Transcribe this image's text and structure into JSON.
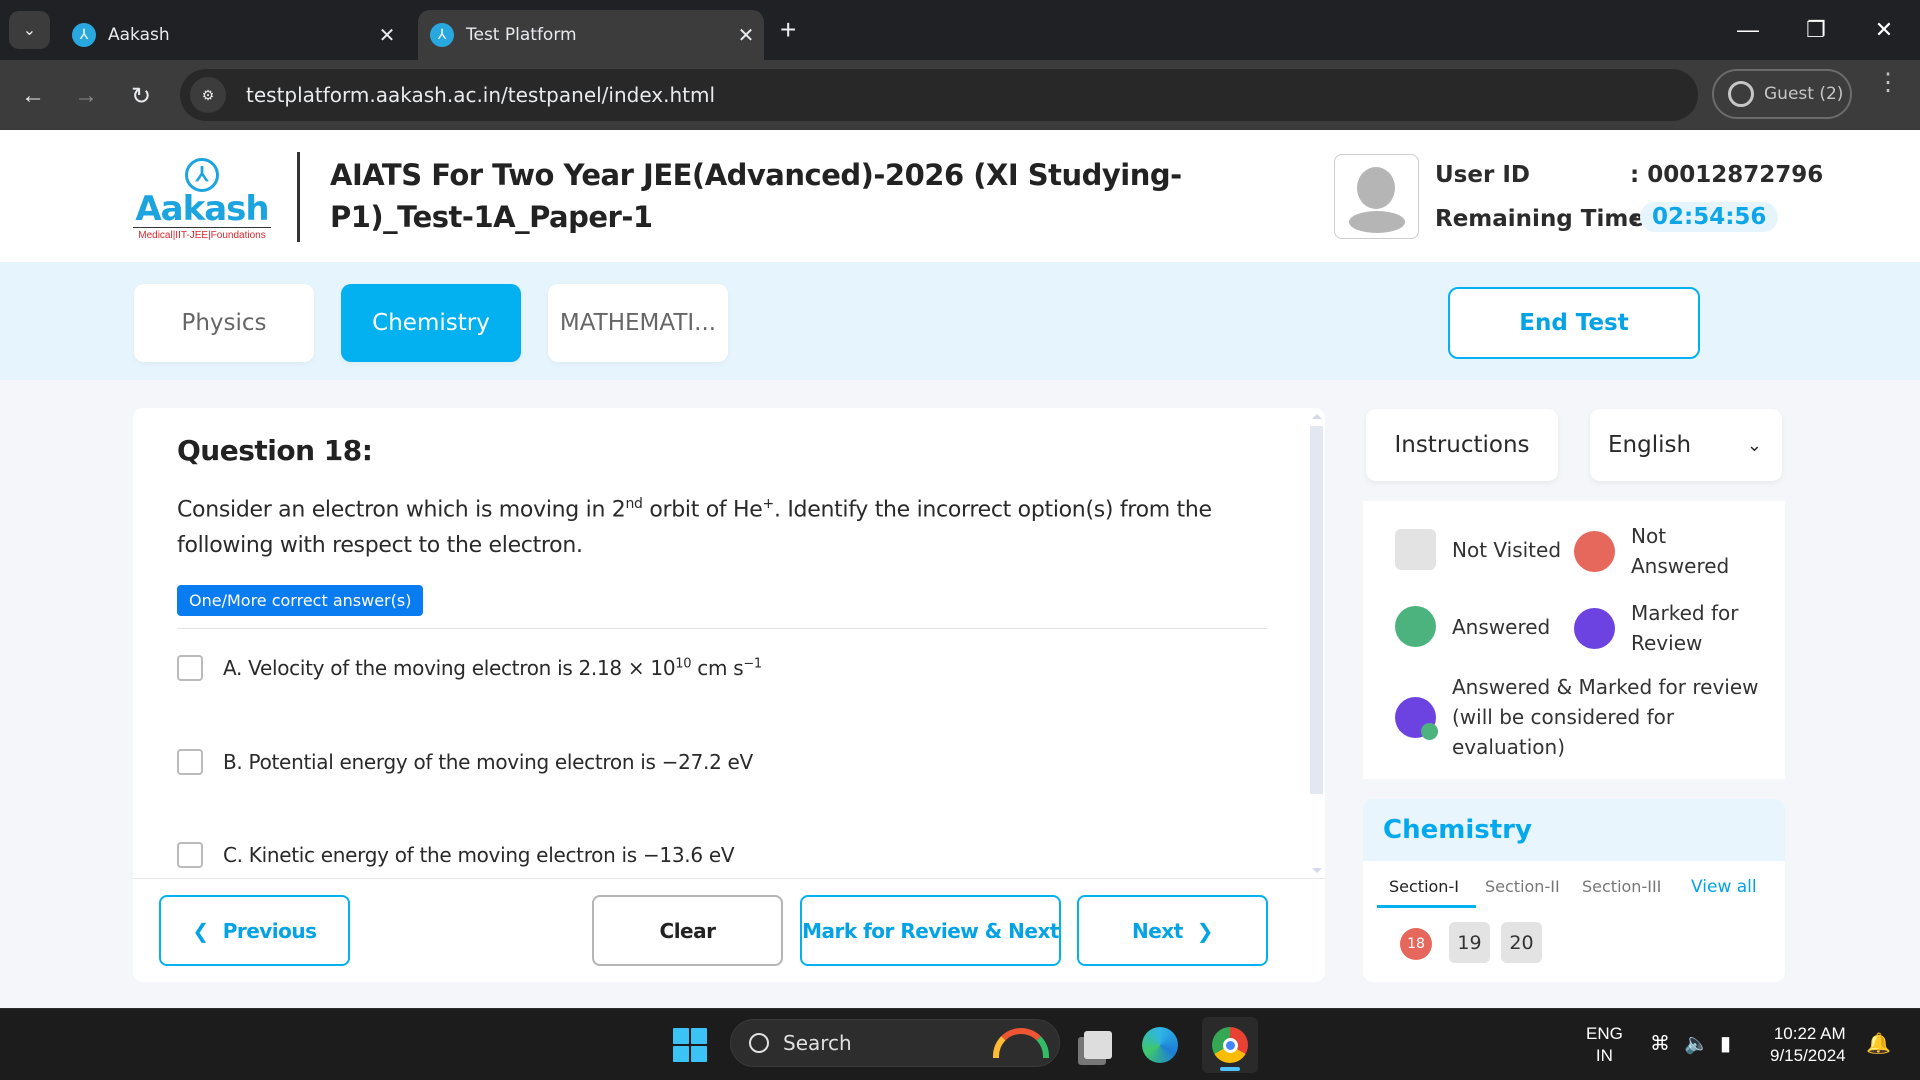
{
  "browser": {
    "tabs": [
      {
        "label": "Aakash",
        "active": false
      },
      {
        "label": "Test Platform",
        "active": true
      }
    ],
    "new_tab_symbol": "+",
    "url": "testplatform.aakash.ac.in/testpanel/index.html",
    "profile_label": "Guest (2)",
    "icons": {
      "back": "←",
      "forward": "→",
      "reload": "↻",
      "close": "✕",
      "minimize": "—",
      "restore": "❐",
      "tab_list": "⌄",
      "site_info": "⚙",
      "menu": "⋮"
    }
  },
  "header": {
    "logo": {
      "name": "Aakash",
      "tagline": "Medical|IIT-JEE|Foundations",
      "mark": "⅄"
    },
    "test_title": "AIATS For Two Year JEE(Advanced)-2026 (XI Studying-P1)_Test-1A_Paper-1",
    "user_id_label": "User ID",
    "user_id_value": ": 00012872796",
    "remaining_time_label": "Remaining Time",
    "remaining_time_colon": ":",
    "remaining_time_value": "02:54:56"
  },
  "subjects": {
    "tabs": [
      {
        "label": "Physics",
        "active": false
      },
      {
        "label": "Chemistry",
        "active": true
      },
      {
        "label": "MATHEMATI...",
        "active": false
      }
    ],
    "end_test_label": "End Test"
  },
  "question": {
    "number_label": "Question 18:",
    "text_pre": "Consider an electron which is moving in 2",
    "text_sup1": "nd",
    "text_mid": " orbit of He",
    "text_sup2": "+",
    "text_post": ". Identify the incorrect option(s) from the following with respect to the electron.",
    "type_badge": "One/More correct answer(s)",
    "options": [
      {
        "label": "A. Velocity of the moving electron is 2.18 × 10",
        "sup": "10",
        "suffix": " cm s",
        "suffix_sup": "−1",
        "checked": false
      },
      {
        "label": "B. Potential energy of the moving electron is −27.2 eV",
        "checked": false
      },
      {
        "label": "C. Kinetic energy of the moving electron is −13.6 eV",
        "checked": false
      }
    ]
  },
  "footer_buttons": {
    "previous": "Previous",
    "clear": "Clear",
    "mark_review_next": "Mark for Review & Next",
    "next": "Next"
  },
  "side_panel": {
    "instructions_label": "Instructions",
    "language_selected": "English",
    "legend": [
      {
        "label": "Not Visited",
        "color": "#e3e3e3"
      },
      {
        "label": "Not Answered",
        "color": "#e6675c"
      },
      {
        "label": "Answered",
        "color": "#4db37e"
      },
      {
        "label": "Marked for Review",
        "color": "#6c43e0"
      },
      {
        "label": "Answered & Marked for review (will be considered for evaluation)",
        "color": "#6c43e0"
      }
    ],
    "palette": {
      "subject": "Chemistry",
      "sections": [
        "Section-I",
        "Section-II",
        "Section-III"
      ],
      "active_section": "Section-I",
      "view_all": "View all",
      "questions": [
        {
          "number": "18",
          "status": "not-answered"
        },
        {
          "number": "19",
          "status": "not-visited"
        },
        {
          "number": "20",
          "status": "not-visited"
        }
      ]
    }
  },
  "taskbar": {
    "search_placeholder": "Search",
    "language": "ENG",
    "region": "IN",
    "time": "10:22 AM",
    "date": "9/15/2024"
  },
  "colors": {
    "accent": "#03b0f0",
    "badge_blue": "#0a7cf2",
    "not_answered": "#e6675c",
    "answered": "#4db37e",
    "marked": "#6c43e0"
  }
}
